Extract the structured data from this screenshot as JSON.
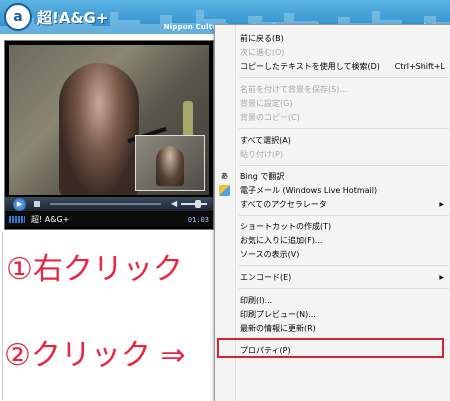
{
  "banner": {
    "logo_glyph": "a",
    "title": "超!A&G+",
    "subtitle": "Nippon Cultural Broadcasting Inc. Anime&Game Zone JOQR Website"
  },
  "player": {
    "station_label": "超! A&G+",
    "time": "01:03"
  },
  "annotations": {
    "step1": "①右クリック",
    "step2": "②クリック ⇒"
  },
  "context_menu": {
    "items": [
      {
        "label": "前に戻る(B)",
        "shortcut": "",
        "disabled": false
      },
      {
        "label": "次に進む(O)",
        "shortcut": "",
        "disabled": true
      },
      {
        "label": "コピーしたテキストを使用して検索(D)",
        "shortcut": "Ctrl+Shift+L",
        "disabled": false
      },
      {
        "label": "名前を付けて背景を保存(S)...",
        "shortcut": "",
        "disabled": true
      },
      {
        "label": "背景に設定(G)",
        "shortcut": "",
        "disabled": true
      },
      {
        "label": "背景のコピー(C)",
        "shortcut": "",
        "disabled": true
      },
      {
        "label": "すべて選択(A)",
        "shortcut": "",
        "disabled": false
      },
      {
        "label": "貼り付け(P)",
        "shortcut": "",
        "disabled": true
      },
      {
        "label": "Bing で翻訳",
        "shortcut": "",
        "disabled": false,
        "icon": "bing-translate-icon"
      },
      {
        "label": "電子メール (Windows Live Hotmail)",
        "shortcut": "",
        "disabled": false,
        "icon": "mail-icon"
      },
      {
        "label": "すべてのアクセラレータ",
        "shortcut": "",
        "disabled": false,
        "submenu": true
      },
      {
        "label": "ショートカットの作成(T)",
        "shortcut": "",
        "disabled": false
      },
      {
        "label": "お気に入りに追加(F)...",
        "shortcut": "",
        "disabled": false
      },
      {
        "label": "ソースの表示(V)",
        "shortcut": "",
        "disabled": false
      },
      {
        "label": "エンコード(E)",
        "shortcut": "",
        "disabled": false,
        "submenu": true
      },
      {
        "label": "印刷(I)...",
        "shortcut": "",
        "disabled": false
      },
      {
        "label": "印刷プレビュー(N)...",
        "shortcut": "",
        "disabled": false
      },
      {
        "label": "最新の情報に更新(R)",
        "shortcut": "",
        "disabled": false
      },
      {
        "label": "プロパティ(P)",
        "shortcut": "",
        "disabled": false,
        "highlighted": true
      }
    ],
    "highlight_color": "#d9242f"
  },
  "colors": {
    "annotation": "#e8263f",
    "banner": "#2f86c6"
  }
}
